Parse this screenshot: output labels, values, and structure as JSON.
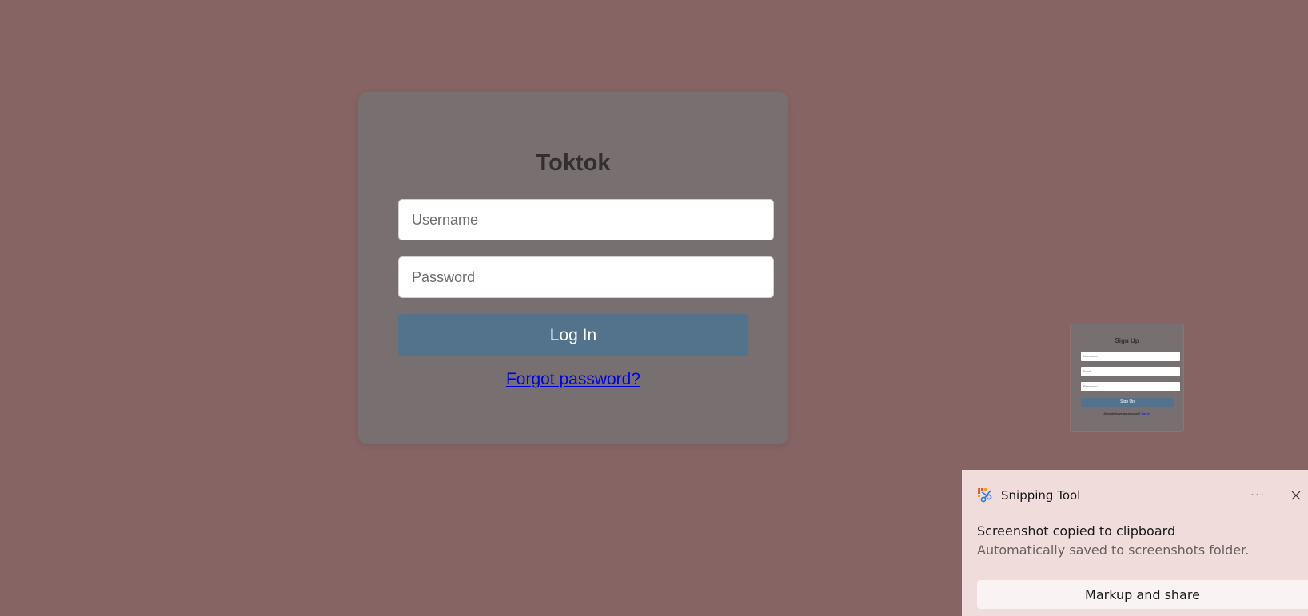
{
  "login": {
    "title": "Toktok",
    "username_placeholder": "Username",
    "password_placeholder": "Password",
    "login_button": "Log In",
    "forgot_link": "Forgot password?"
  },
  "snip_preview": {
    "title": "Sign Up",
    "field1": "Username",
    "field2": "Email",
    "field3": "Password",
    "button": "Sign Up",
    "footer_text": "Already have an account? ",
    "footer_link": "Log in"
  },
  "notification": {
    "app_name": "Snipping Tool",
    "more_label": "···",
    "message": "Screenshot copied to clipboard",
    "sub_message": "Automatically saved to screenshots folder.",
    "action_button": "Markup and share"
  },
  "colors": {
    "page_background": "#856463",
    "card_background": "#787070",
    "button_accent": "#53738c",
    "link": "#0000ee",
    "toast_background": "#f1dcdc"
  }
}
